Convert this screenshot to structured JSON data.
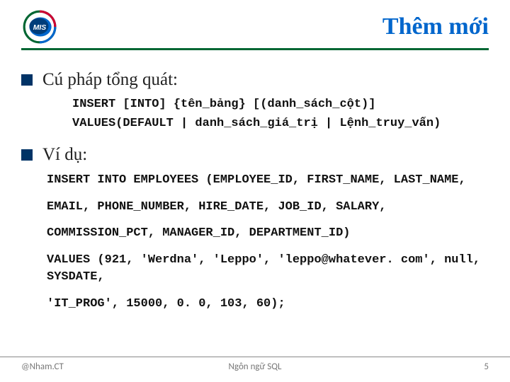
{
  "title": "Thêm mới",
  "logo_text": "MIS",
  "section1": {
    "heading": "Cú pháp tổng quát:",
    "code_line1": "INSERT [INTO] {tên_bảng} [(danh_sách_cột)]",
    "code_line2": "VALUES(DEFAULT | danh_sách_giá_trị | Lệnh_truy_vấn)"
  },
  "section2": {
    "heading": "Ví dụ:",
    "ex_line1": "INSERT INTO EMPLOYEES (EMPLOYEE_ID, FIRST_NAME, LAST_NAME,",
    "ex_line2": "EMAIL, PHONE_NUMBER, HIRE_DATE, JOB_ID, SALARY,",
    "ex_line3": "COMMISSION_PCT, MANAGER_ID, DEPARTMENT_ID)",
    "ex_line4": "VALUES (921, 'Werdna', 'Leppo', 'leppo@whatever. com', null, SYSDATE,",
    "ex_line5": "'IT_PROG', 15000, 0. 0, 103, 60);"
  },
  "footer": {
    "left": "@Nham.CT",
    "center": "Ngôn ngữ SQL",
    "right": "5"
  }
}
